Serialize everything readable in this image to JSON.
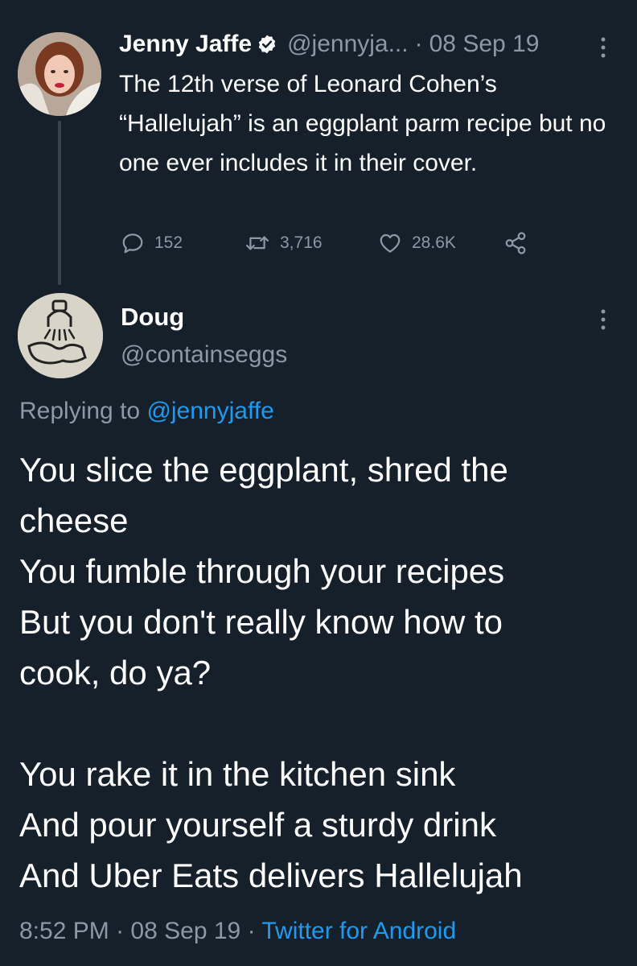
{
  "parent_tweet": {
    "author_name": "Jenny Jaffe",
    "handle": "@jennyja...",
    "date": "08 Sep 19",
    "separator": "·",
    "text": "The 12th verse of Leonard Cohen’s “Hallelujah” is an eggplant parm recipe but no one ever includes it in their cover.",
    "replies": "152",
    "retweets": "3,716",
    "likes": "28.6K"
  },
  "reply_tweet": {
    "author_name": "Doug",
    "handle": "@containseggs",
    "replying_prefix": "Replying to",
    "replying_to": "@jennyjaffe",
    "body_lines": [
      "You slice the eggplant, shred the",
      "cheese",
      "You fumble through your recipes",
      "But you don't really know how to",
      "cook, do ya?",
      "",
      "You rake it in the kitchen sink",
      "And pour yourself a sturdy drink",
      "And Uber Eats delivers Hallelujah"
    ],
    "time": "8:52 PM",
    "date": "08 Sep 19",
    "separator": "·",
    "source": "Twitter for Android"
  },
  "icons": {
    "verified": "verified-badge-icon",
    "more": "more-vertical-icon",
    "reply": "reply-icon",
    "retweet": "retweet-icon",
    "like": "heart-icon",
    "share": "share-icon"
  },
  "colors": {
    "background": "#15202b",
    "text": "#ffffff",
    "secondary": "#8b98a5",
    "link": "#1d9bf0",
    "thread_line": "#38444d"
  }
}
